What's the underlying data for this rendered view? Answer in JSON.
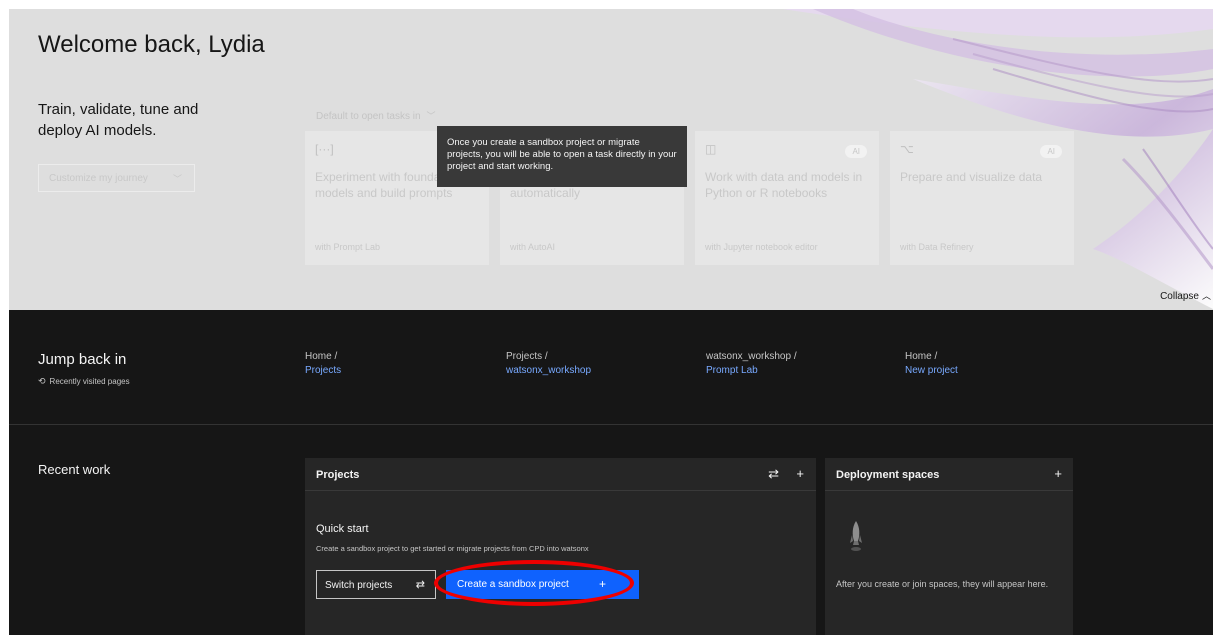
{
  "hero": {
    "welcome": "Welcome back, Lydia",
    "tagline": "Train, validate, tune and deploy AI models.",
    "customize_label": "Customize my journey",
    "default_open_label": "Default to open tasks in",
    "collapse_label": "Collapse",
    "tasks": [
      {
        "icon": "prompt-brackets-icon",
        "icon_glyph": "[···]",
        "description": "Experiment with foundation models and build prompts",
        "tool": "with Prompt Lab",
        "badge": ""
      },
      {
        "icon": "autoai-icon",
        "icon_glyph": "",
        "description": "automatically",
        "tool": "with AutoAI",
        "badge": ""
      },
      {
        "icon": "notebook-icon",
        "icon_glyph": "◫",
        "description": "Work with data and models in Python or R notebooks",
        "tool": "with Jupyter notebook editor",
        "badge": "AI"
      },
      {
        "icon": "data-refinery-icon",
        "icon_glyph": "⌥",
        "description": "Prepare and visualize data",
        "tool": "with Data Refinery",
        "badge": "AI"
      }
    ],
    "tooltip": "Once you create a sandbox project or migrate projects, you will be able to open a task directly in your project and start working."
  },
  "jump_back": {
    "title": "Jump back in",
    "subtitle": "Recently visited pages",
    "crumbs": [
      {
        "parent": "Home /",
        "link": "Projects"
      },
      {
        "parent": "Projects /",
        "link": "watsonx_workshop"
      },
      {
        "parent": "watsonx_workshop /",
        "link": "Prompt Lab"
      },
      {
        "parent": "Home /",
        "link": "New project"
      }
    ]
  },
  "recent_work": {
    "title": "Recent work",
    "projects": {
      "title": "Projects",
      "quick_start_title": "Quick start",
      "quick_start_desc": "Create a sandbox project to get started or migrate projects from CPD into watsonx",
      "switch_label": "Switch projects",
      "create_label": "Create a sandbox project"
    },
    "spaces": {
      "title": "Deployment spaces",
      "empty_text": "After you create or join spaces, they will appear here."
    }
  },
  "colors": {
    "primary_button": "#0f62fe",
    "link": "#78a9ff",
    "highlight_ellipse": "#ee0000"
  }
}
